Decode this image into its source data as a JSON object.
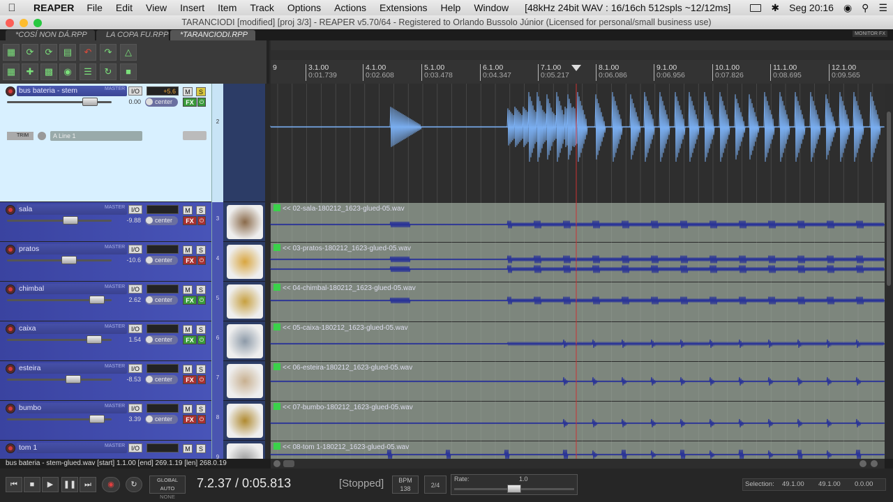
{
  "menubar": {
    "apple": "",
    "app": "REAPER",
    "items": [
      "File",
      "Edit",
      "View",
      "Insert",
      "Item",
      "Track",
      "Options",
      "Actions",
      "Extensions",
      "Help",
      "Window"
    ],
    "status": "[48kHz 24bit WAV : 16/16ch 512spls ~12/12ms]",
    "datetime": "Seg 20:16"
  },
  "window": {
    "title": "TARANCIODI [modified] [proj 3/3] - REAPER v5.70/64 - Registered to Orlando Bussolo Júnior (Licensed for personal/small business use)"
  },
  "tabs": [
    "*COSÍ NON DÁ.RPP",
    "LA COPA FU.RPP",
    "*TARANCIODI.RPP"
  ],
  "monitor_fx": "MONITOR FX",
  "ruler": [
    {
      "bar": "3.1.00",
      "time": "0:01.739"
    },
    {
      "bar": "4.1.00",
      "time": "0:02.608"
    },
    {
      "bar": "5.1.00",
      "time": "0:03.478"
    },
    {
      "bar": "6.1.00",
      "time": "0:04.347"
    },
    {
      "bar": "7.1.00",
      "time": "0:05.217"
    },
    {
      "bar": "8.1.00",
      "time": "0:06.086"
    },
    {
      "bar": "9.1.00",
      "time": "0:06.956"
    },
    {
      "bar": "10.1.00",
      "time": "0:07.826"
    },
    {
      "bar": "11.1.00",
      "time": "0:08.695"
    },
    {
      "bar": "12.1.00",
      "time": "0:09.565"
    }
  ],
  "ruler_first_label": "9",
  "tracks": [
    {
      "name": "bus bateria - stem",
      "num": "2",
      "vol": "0.00",
      "peak": "+5.6",
      "pan": "center",
      "fx": "FX",
      "auto_mode": "TRIM",
      "input": "A Line 1",
      "item": ""
    },
    {
      "name": "sala",
      "num": "3",
      "vol": "-9.88",
      "peak": "",
      "pan": "center",
      "fx": "FX",
      "item": "<< 02-sala-180212_1623-glued-05.wav"
    },
    {
      "name": "pratos",
      "num": "4",
      "vol": "-10.6",
      "peak": "",
      "pan": "center",
      "fx": "FX",
      "item": "<< 03-pratos-180212_1623-glued-05.wav"
    },
    {
      "name": "chimbal",
      "num": "5",
      "vol": "2.62",
      "peak": "",
      "pan": "center",
      "fx": "FX",
      "item": "<< 04-chimbal-180212_1623-glued-05.wav"
    },
    {
      "name": "caixa",
      "num": "6",
      "vol": "1.54",
      "peak": "",
      "pan": "center",
      "fx": "FX",
      "item": "<< 05-caixa-180212_1623-glued-05.wav"
    },
    {
      "name": "esteira",
      "num": "7",
      "vol": "-8.53",
      "peak": "",
      "pan": "center",
      "fx": "FX",
      "item": "<< 06-esteira-180212_1623-glued-05.wav"
    },
    {
      "name": "bumbo",
      "num": "8",
      "vol": "3.39",
      "peak": "",
      "pan": "center",
      "fx": "FX",
      "item": "<< 07-bumbo-180212_1623-glued-05.wav"
    },
    {
      "name": "tom 1",
      "num": "9",
      "vol": "",
      "peak": "",
      "pan": "",
      "fx": "",
      "item": "<< 08-tom 1-180212_1623-glued-05.wav"
    }
  ],
  "master_send_label": "MASTER",
  "io_label": "I/O",
  "mute_label": "M",
  "solo_label": "S",
  "status_line": "bus bateria - stem-glued.wav [start] 1.1.00 [end] 269.1.19 [len] 268.0.19",
  "transport": {
    "position": "7.2.37 / 0:05.813",
    "state": "[Stopped]",
    "bpm_label": "BPM",
    "bpm": "138",
    "timesig": "2/4",
    "rate_label": "Rate:",
    "rate": "1.0",
    "global_auto": "GLOBAL AUTO",
    "global_auto_mode": "NONE",
    "selection_label": "Selection:",
    "sel_start": "49.1.00",
    "sel_end": "49.1.00",
    "sel_len": "0.0.00"
  },
  "colors": {
    "item_bg": "#7d867d",
    "waveform_dark": "#2b3597",
    "waveform_light": "#7aaef0",
    "tcp_blue": "#4a55b0",
    "track_light": "#d8f0ff",
    "edit_cursor": "#cc3333"
  }
}
